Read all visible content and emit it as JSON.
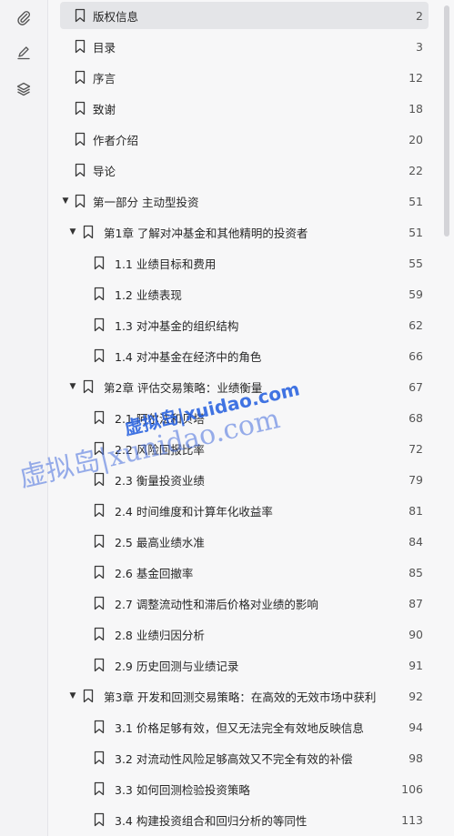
{
  "rail": {
    "icons": [
      "paperclip-icon",
      "pen-icon",
      "layers-icon"
    ]
  },
  "toc": [
    {
      "label": "版权信息",
      "page": "2",
      "level": 0,
      "caret": false,
      "active": true
    },
    {
      "label": "目录",
      "page": "3",
      "level": 0,
      "caret": false
    },
    {
      "label": "序言",
      "page": "12",
      "level": 0,
      "caret": false
    },
    {
      "label": "致谢",
      "page": "18",
      "level": 0,
      "caret": false
    },
    {
      "label": "作者介绍",
      "page": "20",
      "level": 0,
      "caret": false
    },
    {
      "label": "导论",
      "page": "22",
      "level": 0,
      "caret": false
    },
    {
      "label": "第一部分 主动型投资",
      "page": "51",
      "level": 0,
      "caret": true
    },
    {
      "label": "第1章 了解对冲基金和其他精明的投资者",
      "page": "51",
      "level": 1,
      "caret": true
    },
    {
      "label": "1.1 业绩目标和费用",
      "page": "55",
      "level": 2,
      "caret": false
    },
    {
      "label": "1.2 业绩表现",
      "page": "59",
      "level": 2,
      "caret": false
    },
    {
      "label": "1.3 对冲基金的组织结构",
      "page": "62",
      "level": 2,
      "caret": false
    },
    {
      "label": "1.4 对冲基金在经济中的角色",
      "page": "66",
      "level": 2,
      "caret": false
    },
    {
      "label": "第2章 评估交易策略：业绩衡量",
      "page": "67",
      "level": 1,
      "caret": true
    },
    {
      "label": "2.1 阿尔法和贝塔",
      "page": "68",
      "level": 2,
      "caret": false
    },
    {
      "label": "2.2 风险回报比率",
      "page": "72",
      "level": 2,
      "caret": false
    },
    {
      "label": "2.3 衡量投资业绩",
      "page": "79",
      "level": 2,
      "caret": false
    },
    {
      "label": "2.4 时间维度和计算年化收益率",
      "page": "81",
      "level": 2,
      "caret": false
    },
    {
      "label": "2.5 最高业绩水准",
      "page": "84",
      "level": 2,
      "caret": false
    },
    {
      "label": "2.6 基金回撤率",
      "page": "85",
      "level": 2,
      "caret": false
    },
    {
      "label": "2.7 调整流动性和滞后价格对业绩的影响",
      "page": "87",
      "level": 2,
      "caret": false
    },
    {
      "label": "2.8 业绩归因分析",
      "page": "90",
      "level": 2,
      "caret": false
    },
    {
      "label": "2.9 历史回测与业绩记录",
      "page": "91",
      "level": 2,
      "caret": false
    },
    {
      "label": "第3章 开发和回测交易策略：在高效的无效市场中获利",
      "page": "92",
      "level": 1,
      "caret": true
    },
    {
      "label": "3.1 价格足够有效，但又无法完全有效地反映信息",
      "page": "94",
      "level": 2,
      "caret": false
    },
    {
      "label": "3.2 对流动性风险足够高效又不完全有效的补偿",
      "page": "98",
      "level": 2,
      "caret": false
    },
    {
      "label": "3.3 如何回测检验投资策略",
      "page": "106",
      "level": 2,
      "caret": false
    },
    {
      "label": "3.4 构建投资组合和回归分析的等同性",
      "page": "113",
      "level": 2,
      "caret": false
    }
  ],
  "watermark": {
    "line1": "虚拟岛|xuidao.com",
    "line2": "虚拟岛|xunidao.com"
  },
  "colors": {
    "active_row": "#e4e5e8",
    "watermark": "#205cde"
  }
}
